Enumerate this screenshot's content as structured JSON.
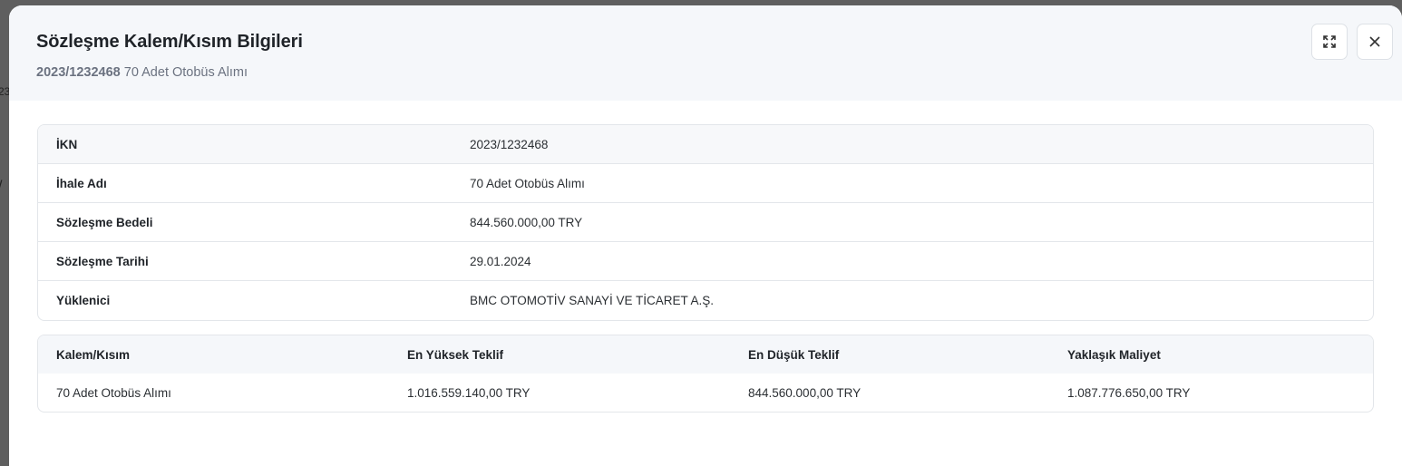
{
  "backdrop": {
    "fragment_1": "23",
    "fragment_2": "/"
  },
  "modal": {
    "title": "Sözleşme Kalem/Kısım Bilgileri",
    "subtitle_ikn": "2023/1232468",
    "subtitle_name": "70 Adet Otobüs Alımı",
    "actions": {
      "fullscreen_icon": "expand-icon",
      "close_icon": "close-icon"
    }
  },
  "info": {
    "rows": [
      {
        "label": "İKN",
        "value": "2023/1232468"
      },
      {
        "label": "İhale Adı",
        "value": "70 Adet Otobüs Alımı"
      },
      {
        "label": "Sözleşme Bedeli",
        "value": "844.560.000,00 TRY"
      },
      {
        "label": "Sözleşme Tarihi",
        "value": "29.01.2024"
      },
      {
        "label": "Yüklenici",
        "value": "BMC OTOMOTİV SANAYİ VE TİCARET A.Ş."
      }
    ]
  },
  "items": {
    "headers": [
      "Kalem/Kısım",
      "En Yüksek Teklif",
      "En Düşük Teklif",
      "Yaklaşık Maliyet"
    ],
    "rows": [
      [
        "70 Adet Otobüs Alımı",
        "1.016.559.140,00 TRY",
        "844.560.000,00 TRY",
        "1.087.776.650,00 TRY"
      ]
    ]
  }
}
